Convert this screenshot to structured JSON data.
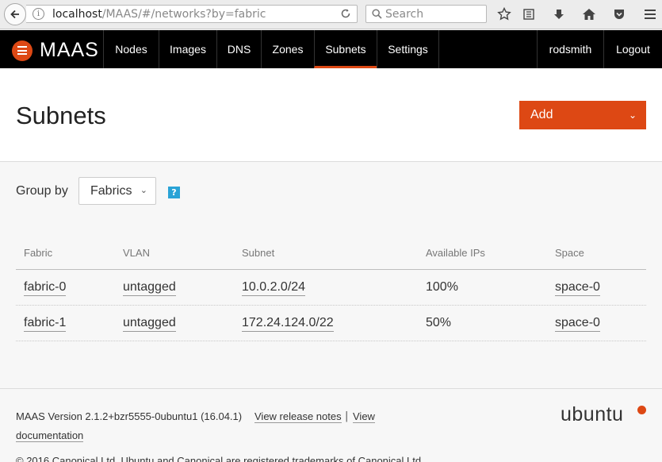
{
  "browser": {
    "url_host": "localhost",
    "url_path": "/MAAS/#/networks?by=fabric",
    "search_placeholder": "Search"
  },
  "nav": {
    "logo": "MAAS",
    "items": [
      "Nodes",
      "Images",
      "DNS",
      "Zones",
      "Subnets",
      "Settings"
    ],
    "active": "Subnets",
    "user": "rodsmith",
    "logout": "Logout"
  },
  "page": {
    "title": "Subnets",
    "add_label": "Add"
  },
  "groupby": {
    "label": "Group by",
    "value": "Fabrics",
    "help": "?"
  },
  "table": {
    "columns": [
      "Fabric",
      "VLAN",
      "Subnet",
      "Available IPs",
      "Space"
    ],
    "rows": [
      {
        "fabric": "fabric-0",
        "vlan": "untagged",
        "subnet": "10.0.2.0/24",
        "available": "100%",
        "space": "space-0"
      },
      {
        "fabric": "fabric-1",
        "vlan": "untagged",
        "subnet": "172.24.124.0/22",
        "available": "50%",
        "space": "space-0"
      }
    ]
  },
  "footer": {
    "version": "MAAS Version 2.1.2+bzr5555-0ubuntu1 (16.04.1)",
    "release_notes": "View release notes",
    "separator": "|",
    "view": "View",
    "documentation": "documentation",
    "brand": "ubuntu",
    "copyright": "© 2016 Canonical Ltd. Ubuntu and Canonical are registered trademarks of Canonical Ltd."
  },
  "colors": {
    "accent": "#dd4814",
    "navbar": "#000000",
    "help": "#29a3d6"
  }
}
